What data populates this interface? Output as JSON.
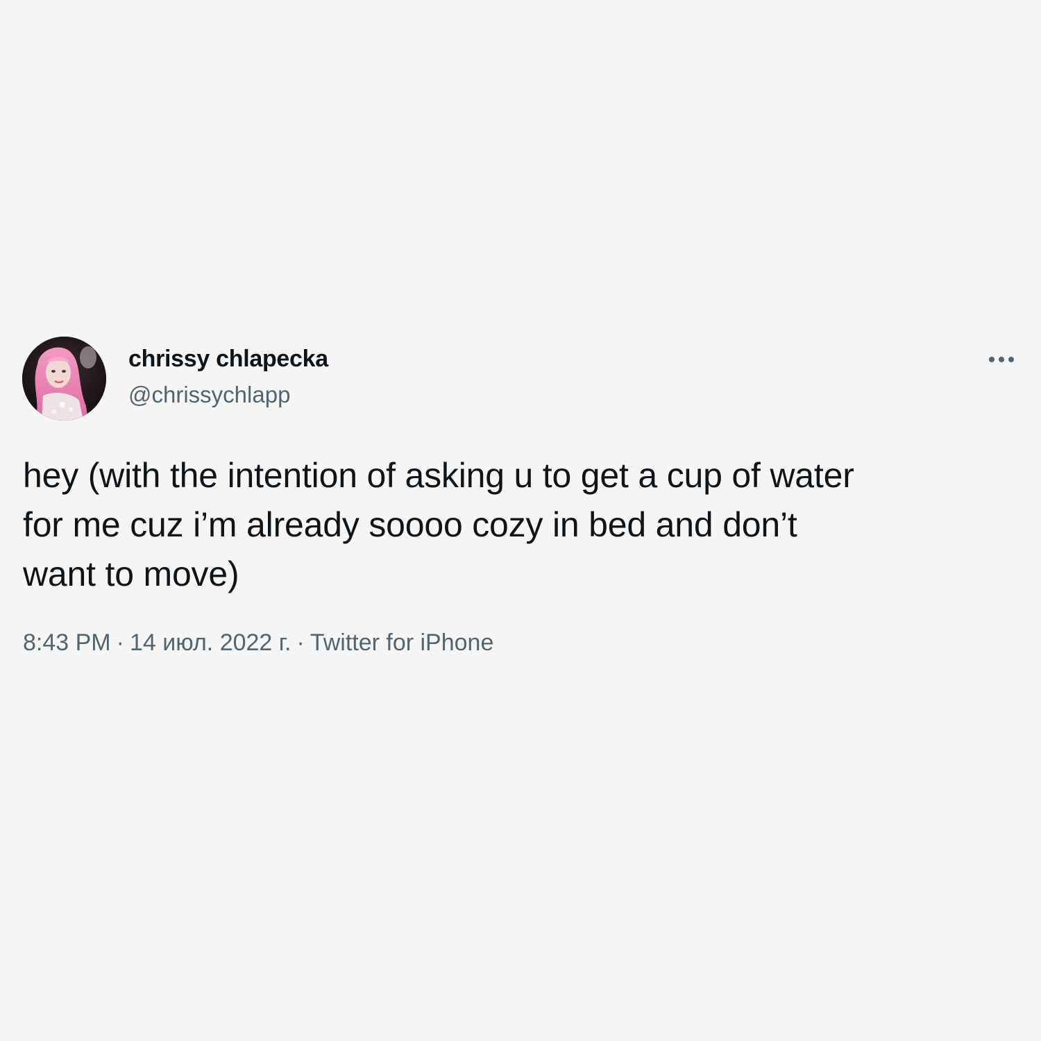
{
  "author": {
    "display_name": "chrissy chlapecka",
    "handle": "@chrissychlapp"
  },
  "tweet": {
    "text": "hey (with the intention of asking u to get a cup of water\nfor me cuz i’m already soooo cozy in bed and don’t\nwant to move)"
  },
  "meta": {
    "time": "8:43 PM",
    "separator": "·",
    "date": "14 июл. 2022 г.",
    "source": "Twitter for iPhone"
  },
  "icons": {
    "more": "more-horizontal-icon"
  },
  "colors": {
    "background": "#f5f5f5",
    "text_primary": "#0f1419",
    "text_secondary": "#536471"
  }
}
